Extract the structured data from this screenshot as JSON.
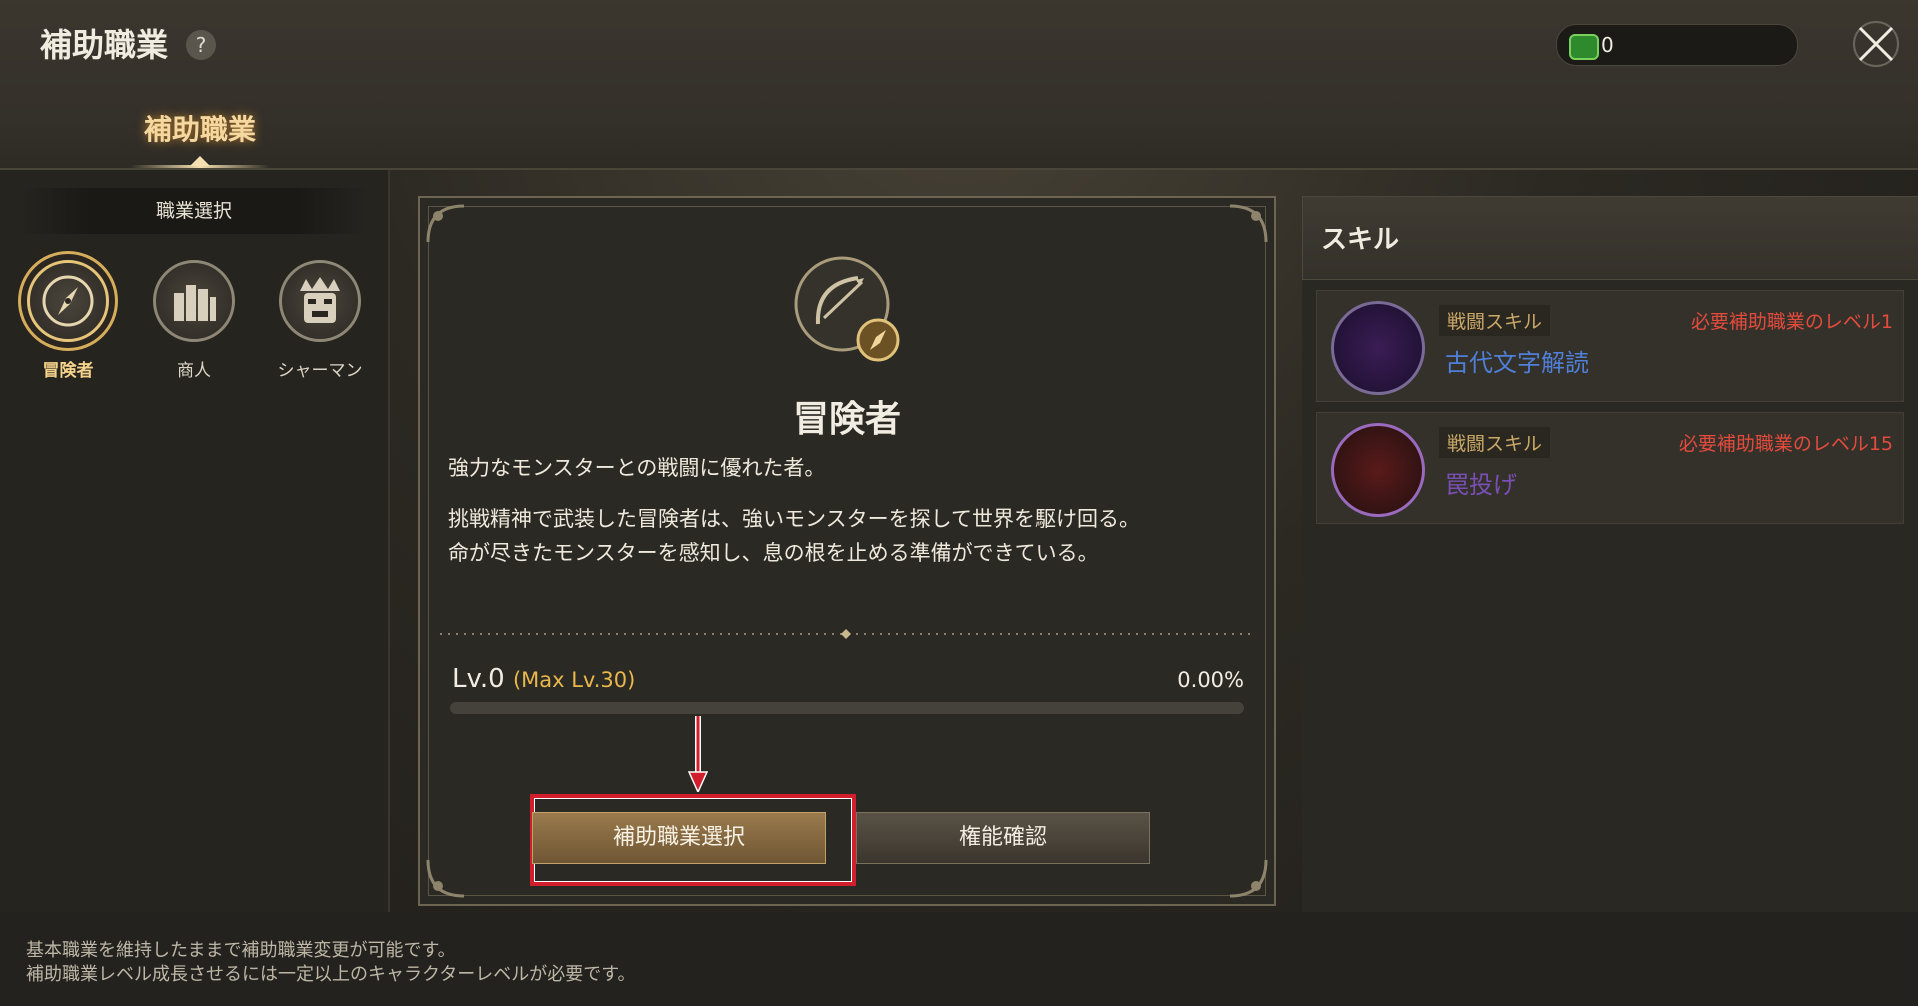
{
  "header": {
    "title": "補助職業",
    "help_label": "?",
    "currency_value": "0",
    "currency_icon": "ticket-icon",
    "close_icon": "close-icon"
  },
  "tabs": [
    {
      "label": "補助職業",
      "selected": true
    }
  ],
  "sidebar": {
    "header": "職業選択",
    "jobs": [
      {
        "label": "冒険者",
        "icon": "compass-icon",
        "selected": true
      },
      {
        "label": "商人",
        "icon": "coins-icon",
        "selected": false
      },
      {
        "label": "シャーマン",
        "icon": "mask-icon",
        "selected": false
      }
    ]
  },
  "detail": {
    "name": "冒険者",
    "description_short": "強力なモンスターとの戦闘に優れた者。",
    "description_long_1": "挑戦精神で武装した冒険者は、強いモンスターを探して世界を駆け回る。",
    "description_long_2": "命が尽きたモンスターを感知し、息の根を止める準備ができている。",
    "level": "Lv.0",
    "max_level": "(Max Lv.30)",
    "progress_text": "0.00%",
    "progress": 0,
    "select_button": "補助職業選択",
    "ability_button": "権能確認"
  },
  "skills": {
    "header": "スキル",
    "items": [
      {
        "tag": "戦闘スキル",
        "requirement": "必要補助職業のレベル1",
        "name": "古代文字解読",
        "name_color": "#4f7fd6"
      },
      {
        "tag": "戦闘スキル",
        "requirement": "必要補助職業のレベル15",
        "name": "罠投げ",
        "name_color": "#7a4fb4"
      }
    ]
  },
  "footer": {
    "line1": "基本職業を維持したままで補助職業変更が可能です。",
    "line2": "補助職業レベル成長させるには一定以上のキャラクターレベルが必要です。"
  },
  "colors": {
    "accent_gold": "#e8b84c",
    "highlight_red": "#d01e2c",
    "requirement_red": "#e34b3d"
  }
}
